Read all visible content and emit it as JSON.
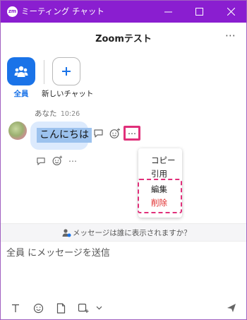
{
  "window": {
    "app_logo_text": "zm",
    "title": "ミーティング チャット",
    "accent_color": "#8a1ed0"
  },
  "header": {
    "title": "Zoomテスト",
    "more_icon": "ellipsis-icon"
  },
  "tabs": [
    {
      "label": "全員",
      "icon": "group-icon",
      "selected": true
    },
    {
      "label": "新しいチャット",
      "icon": "plus-icon",
      "selected": false
    }
  ],
  "message": {
    "sender": "あなた",
    "time": "10:26",
    "text": "こんにちは",
    "actions": [
      "reply-icon",
      "emoji-icon",
      "more-icon"
    ],
    "reactions_row": [
      "reply-icon",
      "add-reaction-icon",
      "more-icon"
    ]
  },
  "context_menu": {
    "items": [
      {
        "label": "コピー",
        "color": "#222222"
      },
      {
        "label": "引用",
        "color": "#222222"
      },
      {
        "label": "編集",
        "color": "#222222"
      },
      {
        "label": "削除",
        "color": "#e02b2b"
      }
    ],
    "highlight_color": "#e0307a"
  },
  "visibility_notice": {
    "text": "メッセージは誰に表示されますか？",
    "icon": "person-lock-icon"
  },
  "composer": {
    "placeholder": "全員 にメッセージを送信",
    "toolbar": [
      "format-text-icon",
      "emoji-icon",
      "file-icon",
      "screenshot-icon",
      "chevron-down-icon"
    ],
    "send_icon": "send-icon"
  }
}
